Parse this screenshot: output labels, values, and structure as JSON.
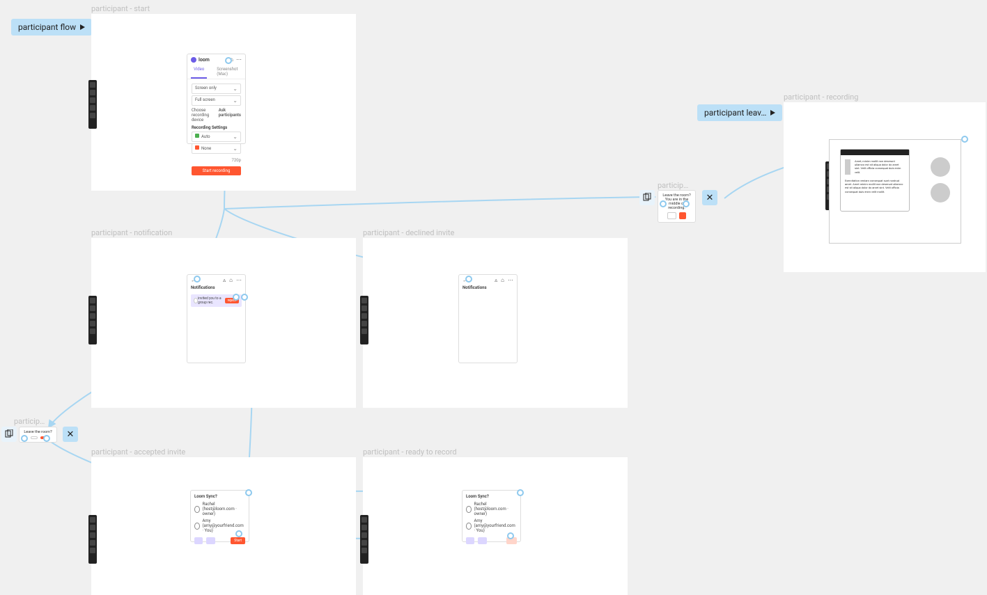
{
  "flows": {
    "participant_flow": {
      "label": "participant flow"
    },
    "participant_leaves": {
      "label": "participant leav…"
    }
  },
  "frames": {
    "start": {
      "title": "participant - start"
    },
    "notification": {
      "title": "participant - notification"
    },
    "declined": {
      "title": "participant - declined invite"
    },
    "accepted": {
      "title": "participant - accepted invite"
    },
    "ready": {
      "title": "participant - ready to record"
    },
    "recording": {
      "title": "participant - recording"
    },
    "popup1": {
      "title": "particip…"
    },
    "popup2": {
      "title": "particip…"
    }
  },
  "loom": {
    "brand": "loom",
    "tabs": {
      "video": "Video",
      "screenshot": "Screenshot (Mac)"
    },
    "screen_only": "Screen only",
    "full_screen": "Full screen",
    "choose_device": "Choose recording device",
    "ask_participants": "Ask participants",
    "settings_title": "Recording Settings",
    "quality": "Auto",
    "delay": "None",
    "start_btn": "Start recording",
    "footer_left": "",
    "footer_right": "720p"
  },
  "notifications": {
    "back": "←",
    "heading": "Notifications",
    "item_text": "invited you to a group rec.",
    "reject": "reject",
    "icons": {
      "bell": "bell-icon",
      "home": "home-icon",
      "more": "more-icon"
    }
  },
  "participants": {
    "title": "Loom Sync?",
    "p1": "Rachel (host@loom.com · owner)",
    "p2": "Amy (amy@yourfriend.com · You)",
    "invite": "",
    "kick": "",
    "start": "Start"
  },
  "popup_leave": {
    "text": "Leave the room?",
    "cancel": "",
    "confirm": ""
  },
  "popup_recording": {
    "text": "Leave the room? You are in the middle of recording.",
    "cancel": "",
    "confirm": ""
  },
  "doc": {
    "p1": "Amet, minim mollit non deserunt ullamco est sit aliqua dolor do amet sint. Velit officia consequat duis enim velit.",
    "p2": "Exercitation veniam consequat sunt nostrud amet. Amet minim mollit non deserunt ullamco est sit aliqua dolor do amet sint. Velit officia consequat duis enim velit mollit."
  }
}
